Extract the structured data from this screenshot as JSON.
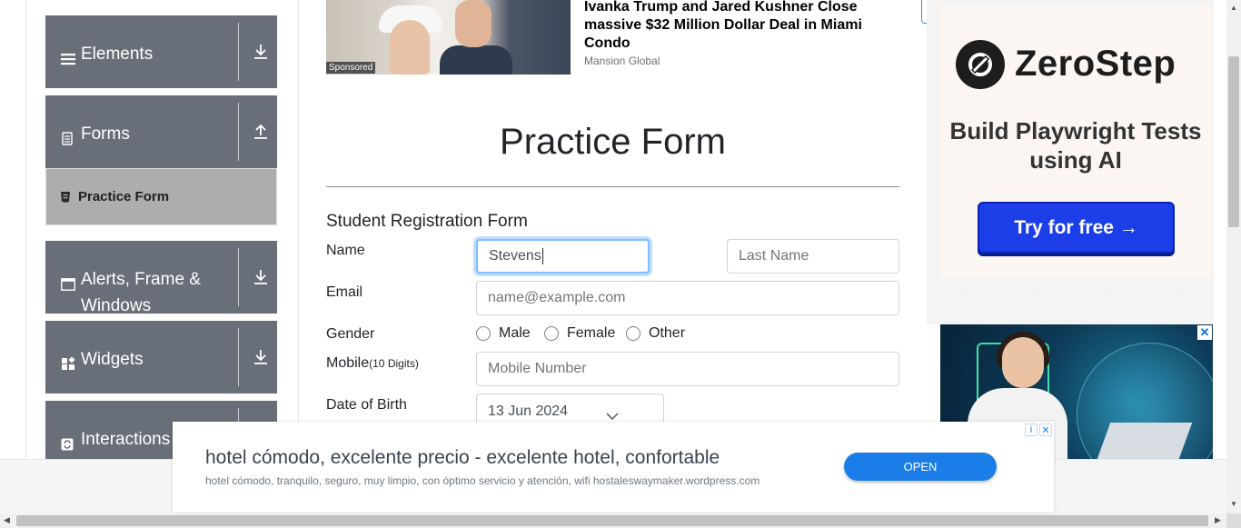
{
  "sidebar": {
    "groups": [
      {
        "label": "Elements",
        "arrow": "down"
      },
      {
        "label": "Forms",
        "arrow": "up"
      },
      {
        "label": "Alerts, Frame & Windows",
        "arrow": "down"
      },
      {
        "label": "Widgets",
        "arrow": "down"
      },
      {
        "label": "Interactions",
        "arrow": "down"
      }
    ],
    "active_item": "Practice Form"
  },
  "top_ad": {
    "badge": "Sponsored",
    "headline": "Ivanka Trump and Jared Kushner Close massive $32 Million Dollar Deal in Miami Condo",
    "source": "Mansion Global"
  },
  "main": {
    "page_title": "Practice Form",
    "form_heading": "Student Registration Form",
    "name_label": "Name",
    "first_name_value": "Stevens",
    "last_name_placeholder": "Last Name",
    "email_label": "Email",
    "email_placeholder": "name@example.com",
    "gender_label": "Gender",
    "gender_options": [
      "Male",
      "Female",
      "Other"
    ],
    "mobile_label": "Mobile",
    "mobile_hint": "(10 Digits)",
    "mobile_placeholder": "Mobile Number",
    "dob_label": "Date of Birth",
    "dob_value": "13 Jun 2024"
  },
  "right_ad": {
    "brand": "ZeroStep",
    "tagline": "Build Playwright Tests using AI",
    "cta": "Try for free →",
    "close": "✕"
  },
  "bottom_ad": {
    "headline": "hotel cómodo, excelente precio - excelente hotel, confortable",
    "sub": "hotel cómodo, tranquilo, seguro, muy limpio, con óptimo servicio y atención, wifi hostaleswaymaker.wordpress.com",
    "cta": "OPEN",
    "info_icon": "i",
    "close_icon": "✕"
  },
  "colors": {
    "sidebar_group": "#686f79",
    "active_item": "#adadad",
    "focus_border": "#80bdff",
    "cta_blue": "#1b3ee8",
    "open_button": "#1a7de8"
  }
}
